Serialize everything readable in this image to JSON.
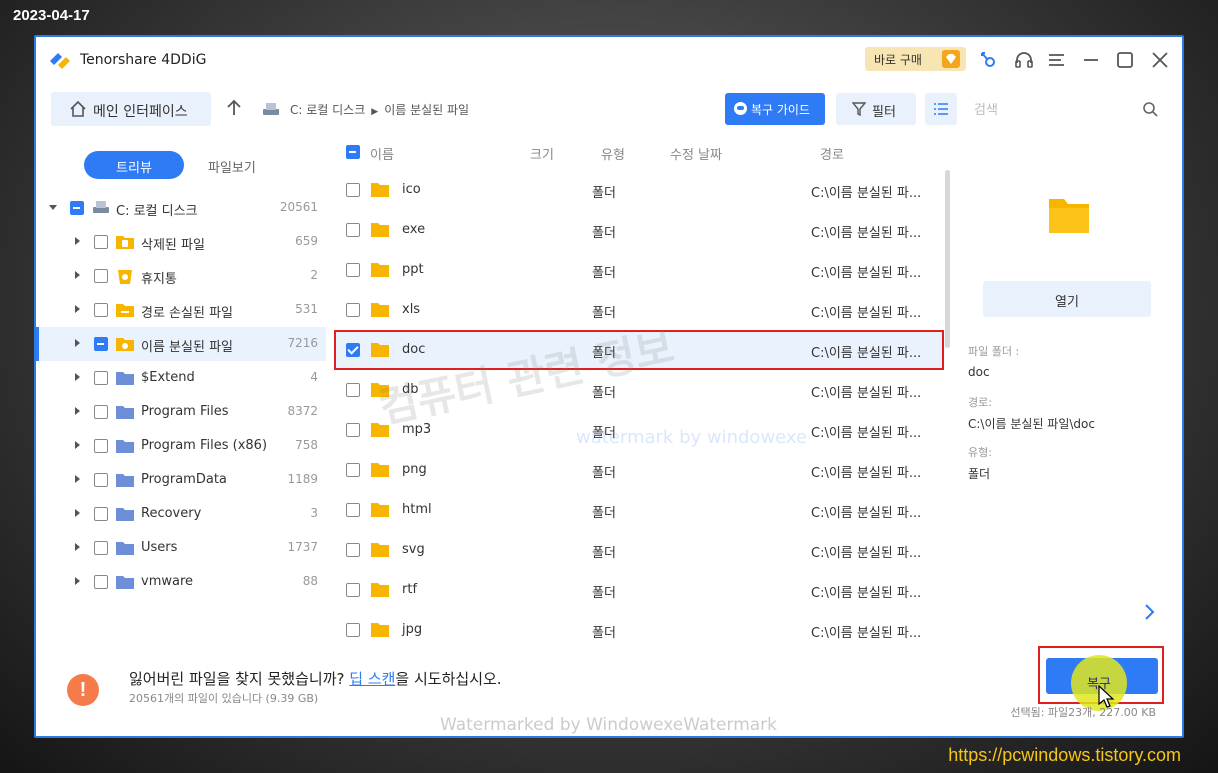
{
  "overlay": {
    "date": "2023-04-17",
    "blog_url": "https://pcwindows.tistory.com",
    "watermark_main": "컴퓨터 관련 정보",
    "watermark_sub": "watermark by windowexe",
    "watermark_bottom": "Watermarked by WindowexeWatermark"
  },
  "titlebar": {
    "app_name": "Tenorshare 4DDiG",
    "buy_label": "바로 구매",
    "icons": [
      "key-icon",
      "headset-icon",
      "menu-icon",
      "minimize-icon",
      "maximize-icon",
      "close-icon"
    ]
  },
  "toolbar": {
    "home_label": "메인 인터페이스",
    "breadcrumb": [
      "C: 로컬 디스크",
      "이름 분실된 파일"
    ],
    "guide_label": "복구 가이드",
    "filter_label": "필터",
    "search_placeholder": "검색"
  },
  "left_panel": {
    "tab_tree": "트리뷰",
    "tab_file": "파일보기",
    "root": {
      "label": "C: 로컬 디스크",
      "count": "20561"
    },
    "items": [
      {
        "label": "삭제된 파일",
        "count": "659",
        "icon": "deleted-folder-icon"
      },
      {
        "label": "휴지통",
        "count": "2",
        "icon": "recycle-bin-icon"
      },
      {
        "label": "경로 손실된 파일",
        "count": "531",
        "icon": "lost-path-folder-icon"
      },
      {
        "label": "이름 분실된 파일",
        "count": "7216",
        "icon": "lost-name-folder-icon"
      },
      {
        "label": "$Extend",
        "count": "4",
        "icon": "folder-icon"
      },
      {
        "label": "Program Files",
        "count": "8372",
        "icon": "folder-icon"
      },
      {
        "label": "Program Files (x86)",
        "count": "758",
        "icon": "folder-icon"
      },
      {
        "label": "ProgramData",
        "count": "1189",
        "icon": "folder-icon"
      },
      {
        "label": "Recovery",
        "count": "3",
        "icon": "folder-icon"
      },
      {
        "label": "Users",
        "count": "1737",
        "icon": "folder-icon"
      },
      {
        "label": "vmware",
        "count": "88",
        "icon": "folder-icon"
      }
    ]
  },
  "file_list": {
    "headers": {
      "name": "이름",
      "size": "크기",
      "type": "유형",
      "modified": "수정 날짜",
      "path": "경로"
    },
    "rows": [
      {
        "name": "ico",
        "type": "폴더",
        "path": "C:\\이름 분실된 파..."
      },
      {
        "name": "exe",
        "type": "폴더",
        "path": "C:\\이름 분실된 파..."
      },
      {
        "name": "ppt",
        "type": "폴더",
        "path": "C:\\이름 분실된 파..."
      },
      {
        "name": "xls",
        "type": "폴더",
        "path": "C:\\이름 분실된 파..."
      },
      {
        "name": "doc",
        "type": "폴더",
        "path": "C:\\이름 분실된 파..."
      },
      {
        "name": "db",
        "type": "폴더",
        "path": "C:\\이름 분실된 파..."
      },
      {
        "name": "mp3",
        "type": "폴더",
        "path": "C:\\이름 분실된 파..."
      },
      {
        "name": "png",
        "type": "폴더",
        "path": "C:\\이름 분실된 파..."
      },
      {
        "name": "html",
        "type": "폴더",
        "path": "C:\\이름 분실된 파..."
      },
      {
        "name": "svg",
        "type": "폴더",
        "path": "C:\\이름 분실된 파..."
      },
      {
        "name": "rtf",
        "type": "폴더",
        "path": "C:\\이름 분실된 파..."
      },
      {
        "name": "jpg",
        "type": "폴더",
        "path": "C:\\이름 분실된 파..."
      }
    ]
  },
  "right_panel": {
    "open_label": "열기",
    "folder_label": "파일 폴더 :",
    "folder_value": "doc",
    "path_label": "경로:",
    "path_value": "C:\\이름 분실된 파일\\doc",
    "type_label": "유형:",
    "type_value": "폴더"
  },
  "footer": {
    "msg_before": "잃어버린 파일을 찾지 못했습니까? ",
    "msg_link": "딥 스캔",
    "msg_after": "을 시도하십시오.",
    "sub": "20561개의 파일이 있습니다 (9.39 GB)",
    "recover_label": "복구",
    "selection_info": "선택됨: 파일23개, 227.00 KB"
  },
  "colors": {
    "accent": "#2f7bf5",
    "folder": "#f7b500",
    "highlight": "#e02020"
  }
}
